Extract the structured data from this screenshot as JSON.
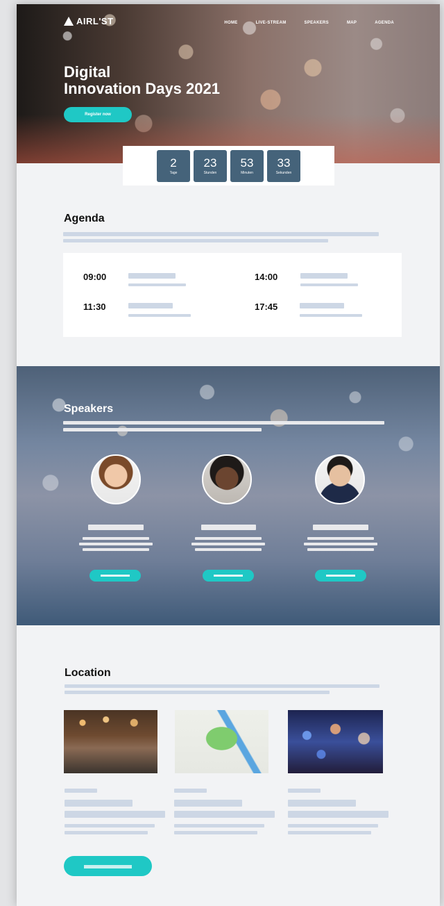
{
  "brand": {
    "logo_text": "AIRL'ST"
  },
  "nav": {
    "items": [
      "HOME",
      "LIVE-STREAM",
      "SPEAKERS",
      "MAP",
      "AGENDA"
    ]
  },
  "hero": {
    "title_line1": "Digital",
    "title_line2": "Innovation Days 2021",
    "register_label": "Register now"
  },
  "countdown": [
    {
      "value": "2",
      "label": "Tage"
    },
    {
      "value": "23",
      "label": "Stunden"
    },
    {
      "value": "53",
      "label": "Minuten"
    },
    {
      "value": "33",
      "label": "Sekunden"
    }
  ],
  "agenda": {
    "heading": "Agenda",
    "times": [
      "09:00",
      "14:00",
      "11:30",
      "17:45"
    ]
  },
  "speakers": {
    "heading": "Speakers"
  },
  "location": {
    "heading": "Location"
  },
  "colors": {
    "accent": "#1fc8c5",
    "countdown_box": "#45637a",
    "placeholder": "#cdd7e5",
    "page_bg": "#f2f3f5"
  }
}
